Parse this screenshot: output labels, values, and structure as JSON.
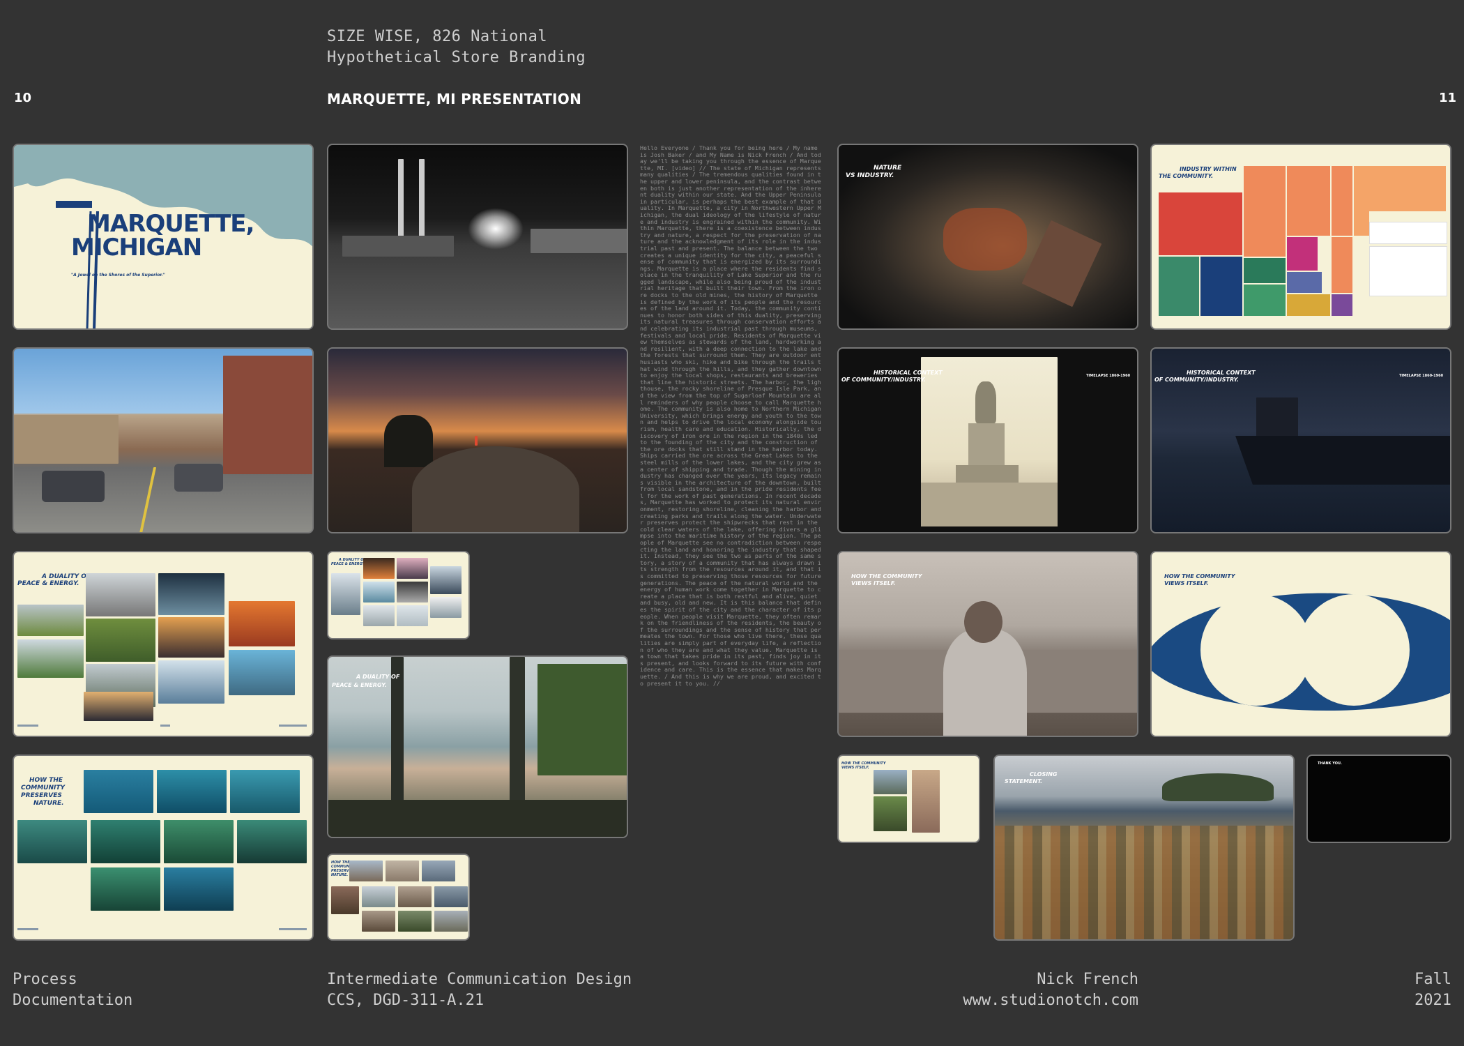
{
  "header": {
    "line1": "SIZE WISE, 826 National",
    "line2": "Hypothetical Store Branding",
    "left_page": "10",
    "right_page": "11",
    "title": "MARQUETTE, MI PRESENTATION"
  },
  "footer": {
    "left_line1": "Process",
    "left_line2": "Documentation",
    "course_line1": "Intermediate Communication Design",
    "course_line2": "CCS, DGD-311-A.21",
    "author": "Nick French",
    "website": "www.studionotch.com",
    "term_line1": "Fall",
    "term_line2": "2021"
  },
  "slides": {
    "title_slide": {
      "line1": "MARQUETTE,",
      "line2": "MICHIGAN",
      "tagline": "\"A Jewel on the Shores of the Superior.\""
    },
    "industry": {
      "title_line1": "INDUSTRY WITHIN",
      "title_line2": "THE COMMUNITY."
    },
    "nature": {
      "title_line1": "NATURE",
      "title_line2": "VS INDUSTRY."
    },
    "historical_1": {
      "title_line1": "HISTORICAL CONTEXT",
      "title_line2": "OF COMMUNITY/INDUSTRY.",
      "tag": "TIMELAPSE 1860-1960"
    },
    "historical_2": {
      "title_line1": "HISTORICAL CONTEXT",
      "title_line2": "OF COMMUNITY/INDUSTRY.",
      "tag": "TIMELAPSE 1860-1960"
    },
    "duality": {
      "title_line1": "A DUALITY OF",
      "title_line2": "PEACE & ENERGY."
    },
    "duality_small": {
      "title_line1": "A DUALITY OF",
      "title_line2": "PEACE & ENERGY."
    },
    "duality_video": {
      "title_line1": "A DUALITY OF",
      "title_line2": "PEACE & ENERGY."
    },
    "views_1": {
      "title_line1": "HOW THE COMMUNITY",
      "title_line2": "VIEWS ITSELF."
    },
    "views_2": {
      "title_line1": "HOW THE COMMUNITY",
      "title_line2": "VIEWS ITSELF."
    },
    "views_small": {
      "title_line1": "HOW THE COMMUNITY",
      "title_line2": "VIEWS ITSELF."
    },
    "preserves": {
      "line1": "HOW THE",
      "line2": "COMMUNITY",
      "line3": "PRESERVES",
      "line4": "NATURE."
    },
    "preserves_small": {
      "line1": "HOW THE",
      "line2": "COMMUNITY",
      "line3": "PRESERVES",
      "line4": "NATURE."
    },
    "closing": {
      "title_line1": "CLOSING",
      "title_line2": "STATEMENT."
    },
    "thanks": {
      "title": "THANK YOU."
    }
  },
  "transcript": "Hello Everyone / Thank you for being here / My name is Josh Baker / and My Name is Nick French / And today we'll be taking you through the essence of Marquette, MI. [video] // The state of Michigan represents many qualities / The tremendous qualities found in the upper and lower peninsula, and the contrast between both is just another representation of the inherent duality within our state. And the Upper Peninsula in particular, is perhaps the best example of that duality. In Marquette, a city in Northwestern Upper Michigan, the dual ideology of the lifestyle of nature and industry is engrained within the community. Within Marquette, there is a coexistence between industry and nature, a respect for the preservation of nature and the acknowledgment of its role in the industrial past and present. The balance between the two creates a unique identity for the city, a peaceful sense of community that is energized by its surroundings. Marquette is a place where the residents find solace in the tranquility of Lake Superior and the rugged landscape, while also being proud of the industrial heritage that built their town. From the iron ore docks to the old mines, the history of Marquette is defined by the work of its people and the resources of the land around it. Today, the community continues to honor both sides of this duality, preserving its natural treasures through conservation efforts and celebrating its industrial past through museums, festivals and local pride. Residents of Marquette view themselves as stewards of the land, hardworking and resilient, with a deep connection to the lake and the forests that surround them. They are outdoor enthusiasts who ski, hike and bike through the trails that wind through the hills, and they gather downtown to enjoy the local shops, restaurants and breweries that line the historic streets. The harbor, the lighthouse, the rocky shoreline of Presque Isle Park, and the view from the top of Sugarloaf Mountain are all reminders of why people choose to call Marquette home. The community is also home to Northern Michigan University, which brings energy and youth to the town and helps to drive the local economy alongside tourism, health care and education. Historically, the discovery of iron ore in the region in the 1840s led to the founding of the city and the construction of the ore docks that still stand in the harbor today. Ships carried the ore across the Great Lakes to the steel mills of the lower lakes, and the city grew as a center of shipping and trade. Though the mining industry has changed over the years, its legacy remains visible in the architecture of the downtown, built from local sandstone, and in the pride residents feel for the work of past generations. In recent decades, Marquette has worked to protect its natural environment, restoring shoreline, cleaning the harbor and creating parks and trails along the water. Underwater preserves protect the shipwrecks that rest in the cold clear waters of the lake, offering divers a glimpse into the maritime history of the region. The people of Marquette see no contradiction between respecting the land and honoring the industry that shaped it. Instead, they see the two as parts of the same story, a story of a community that has always drawn its strength from the resources around it, and that is committed to preserving those resources for future generations. The peace of the natural world and the energy of human work come together in Marquette to create a place that is both restful and alive, quiet and busy, old and new. It is this balance that defines the spirit of the city and the character of its people. When people visit Marquette, they often remark on the friendliness of the residents, the beauty of the surroundings and the sense of history that permeates the town. For those who live there, these qualities are simply part of everyday life, a reflection of who they are and what they value. Marquette is a town that takes pride in its past, finds joy in its present, and looks forward to its future with confidence and care. This is the essence that makes Marquette. / And this is why we are proud, and excited to present it to you. //"
}
